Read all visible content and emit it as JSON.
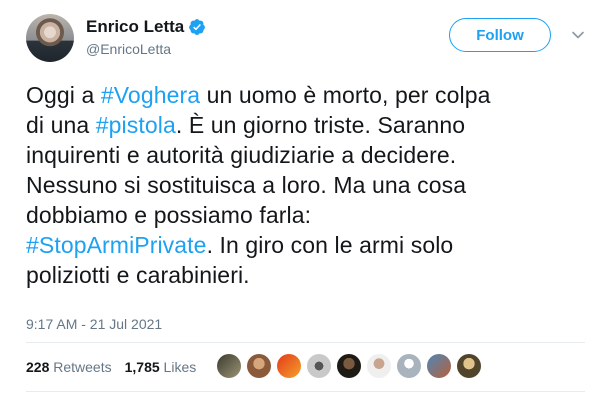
{
  "author": {
    "name": "Enrico Letta",
    "handle": "@EnricoLetta",
    "verified": true
  },
  "follow_button": {
    "label": "Follow"
  },
  "tweet": {
    "lines": [
      [
        {
          "t": "Oggi a "
        },
        {
          "t": "#Voghera",
          "tag": true
        },
        {
          "t": " un uomo è morto, per colpa"
        }
      ],
      [
        {
          "t": "di una "
        },
        {
          "t": "#pistola",
          "tag": true
        },
        {
          "t": ". È un giorno triste. Saranno"
        }
      ],
      [
        {
          "t": "inquirenti e autorità giudiziarie a decidere."
        }
      ],
      [
        {
          "t": "Nessuno si sostituisca a loro. Ma una cosa"
        }
      ],
      [
        {
          "t": "dobbiamo e possiamo farla:"
        }
      ],
      [
        {
          "t": "#StopArmiPrivate",
          "tag": true
        },
        {
          "t": ". In giro con le armi solo"
        }
      ],
      [
        {
          "t": "poliziotti e carabinieri."
        }
      ]
    ]
  },
  "timestamp": "9:17 AM - 21 Jul 2021",
  "stats": {
    "retweets_count": "228",
    "retweets_label": "Retweets",
    "likes_count": "1,785",
    "likes_label": "Likes"
  },
  "colors": {
    "accent": "#1da1f2",
    "text": "#14171a",
    "secondary": "#657786"
  },
  "liker_avatars": [
    {
      "bg": "linear-gradient(135deg,#3b3b2e,#9b9475)"
    },
    {
      "bg": "radial-gradient(circle at 50% 40%,#d7a77c 0 30%,#8a5a3a 31%)"
    },
    {
      "bg": "linear-gradient(135deg,#e23a1b,#f5a12a)"
    },
    {
      "bg": "radial-gradient(circle at 50% 50%,#555 0 25%,#c9c9c9 26%)"
    },
    {
      "bg": "radial-gradient(circle at 50% 40%,#7a5a3f 0 30%,#1e1a16 31%)"
    },
    {
      "bg": "radial-gradient(circle at 50% 40%,#caa58e 0 28%,#efefef 29%)"
    },
    {
      "bg": "radial-gradient(circle at 50% 40%,#ffffff 0 25%,#a8b3bd 26%)"
    },
    {
      "bg": "linear-gradient(135deg,#4f86b8,#b5613a)"
    },
    {
      "bg": "radial-gradient(circle at 50% 40%,#e0c38a 0 30%,#50442c 31%)"
    }
  ]
}
